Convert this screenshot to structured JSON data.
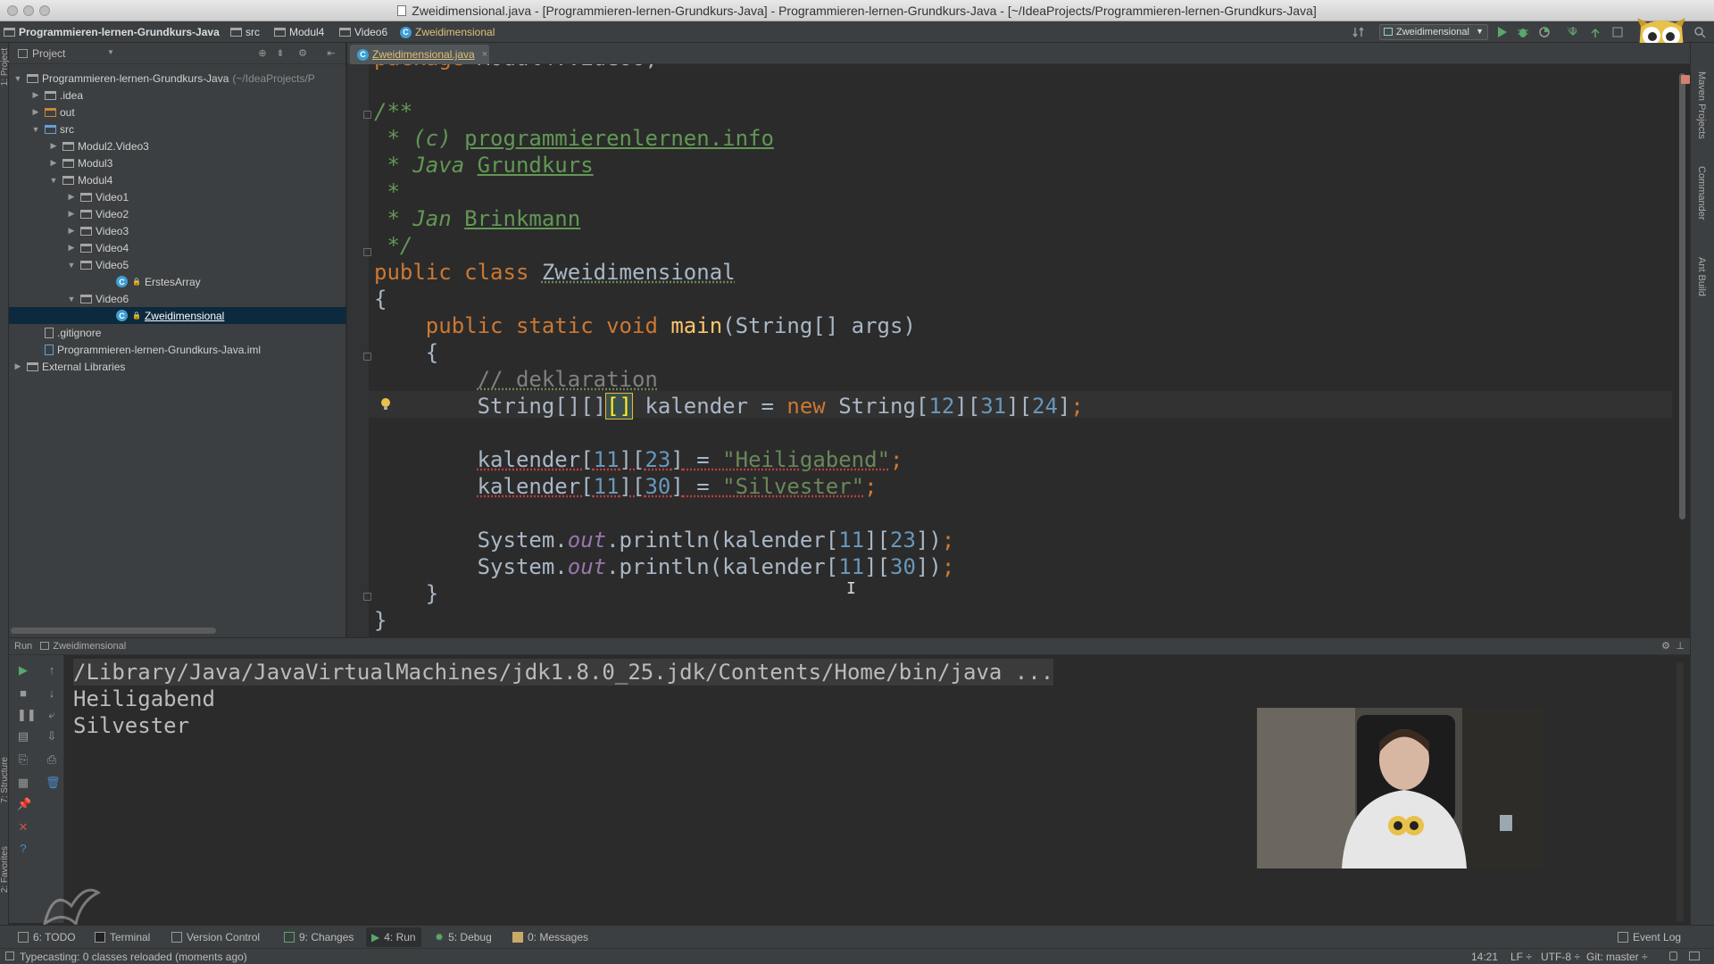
{
  "window": {
    "title": "Zweidimensional.java - [Programmieren-lernen-Grundkurs-Java] - Programmieren-lernen-Grundkurs-Java - [~/IdeaProjects/Programmieren-lernen-Grundkurs-Java]"
  },
  "navbar": {
    "crumbs": [
      "Programmieren-lernen-Grundkurs-Java",
      "src",
      "Modul4",
      "Video6",
      "Zweidimensional"
    ],
    "run_config": "Zweidimensional"
  },
  "project": {
    "header": "Project",
    "tree": [
      {
        "label": "Programmieren-lernen-Grundkurs-Java",
        "sub": "(~/IdeaProjects/P",
        "depth": 0,
        "arrow": "down",
        "kind": "project"
      },
      {
        "label": ".idea",
        "depth": 1,
        "arrow": "right",
        "kind": "folder"
      },
      {
        "label": "out",
        "depth": 1,
        "arrow": "right",
        "kind": "folder-orange"
      },
      {
        "label": "src",
        "depth": 1,
        "arrow": "down",
        "kind": "folder-blue"
      },
      {
        "label": "Modul2.Video3",
        "depth": 2,
        "arrow": "right",
        "kind": "package"
      },
      {
        "label": "Modul3",
        "depth": 2,
        "arrow": "right",
        "kind": "package"
      },
      {
        "label": "Modul4",
        "depth": 2,
        "arrow": "down",
        "kind": "package"
      },
      {
        "label": "Video1",
        "depth": 3,
        "arrow": "right",
        "kind": "package"
      },
      {
        "label": "Video2",
        "depth": 3,
        "arrow": "right",
        "kind": "package"
      },
      {
        "label": "Video3",
        "depth": 3,
        "arrow": "right",
        "kind": "package"
      },
      {
        "label": "Video4",
        "depth": 3,
        "arrow": "right",
        "kind": "package"
      },
      {
        "label": "Video5",
        "depth": 3,
        "arrow": "down",
        "kind": "package"
      },
      {
        "label": "ErstesArray",
        "depth": 5,
        "arrow": "",
        "kind": "class"
      },
      {
        "label": "Video6",
        "depth": 3,
        "arrow": "down",
        "kind": "package"
      },
      {
        "label": "Zweidimensional",
        "depth": 5,
        "arrow": "",
        "kind": "class",
        "selected": true
      },
      {
        "label": ".gitignore",
        "depth": 1,
        "arrow": "",
        "kind": "file"
      },
      {
        "label": "Programmieren-lernen-Grundkurs-Java.iml",
        "depth": 1,
        "arrow": "",
        "kind": "iml"
      },
      {
        "label": "External Libraries",
        "depth": 0,
        "arrow": "right",
        "kind": "library"
      }
    ]
  },
  "editor": {
    "tab_label": "Zweidimensional.java",
    "code": {
      "jd_open": "/**",
      "jd_c": " * (c) ",
      "jd_site": "programmierenlernen.info",
      "jd_java": " * Java ",
      "jd_grundkurs": "Grundkurs",
      "jd_star": " *",
      "jd_author": " * Jan ",
      "jd_brinkmann": "Brinkmann",
      "jd_close": " */",
      "kw_public": "public",
      "kw_class": "class",
      "class_name": "Zweidimensional",
      "brace_open": "{",
      "brace_close": "}",
      "kw_static": "static",
      "kw_void": "void",
      "fn_main": "main",
      "main_params": "(String[] args)",
      "comment": "// deklaration",
      "type_string": "String",
      "arr2": "[][]",
      "arr_hl": "[]",
      "var_kalender": "kalender",
      "assign": " = ",
      "kw_new": "new",
      "n12": "12",
      "n31": "31",
      "n24": "24",
      "n11": "11",
      "n23": "23",
      "n30": "30",
      "s_heiligabend": "\"Heiligabend\"",
      "s_silvester": "\"Silvester\"",
      "system": "System.",
      "out_field": "out",
      "println": ".println(",
      "semicolon": ";"
    }
  },
  "run": {
    "header_label": "Run",
    "config_name": "Zweidimensional",
    "console": [
      "/Library/Java/JavaVirtualMachines/jdk1.8.0_25.jdk/Contents/Home/bin/java ...",
      "Heiligabend",
      "Silvester"
    ]
  },
  "tool_windows": {
    "todo": "6: TODO",
    "terminal": "Terminal",
    "version_control": "Version Control",
    "changes": "9: Changes",
    "run": "4: Run",
    "debug": "5: Debug",
    "messages": "0: Messages",
    "event_log": "Event Log"
  },
  "side_labels": {
    "project": "1: Project",
    "structure": "7: Structure",
    "favorites": "2: Favorites",
    "maven": "Maven Projects",
    "commander": "Commander",
    "ant": "Ant Build"
  },
  "status": {
    "message": "Typecasting: 0 classes reloaded (moments ago)",
    "position": "14:21",
    "line_sep": "LF ÷",
    "encoding": "UTF-8 ÷",
    "git": "Git: master ÷"
  },
  "colors": {
    "editor_bg": "#2b2b2b",
    "panel_bg": "#3c3f41",
    "keyword": "#cc7832",
    "string": "#6a8759",
    "number": "#6897bb",
    "javadoc": "#629755",
    "method": "#ffc66d",
    "field": "#9876aa",
    "selection": "#0d293e"
  }
}
